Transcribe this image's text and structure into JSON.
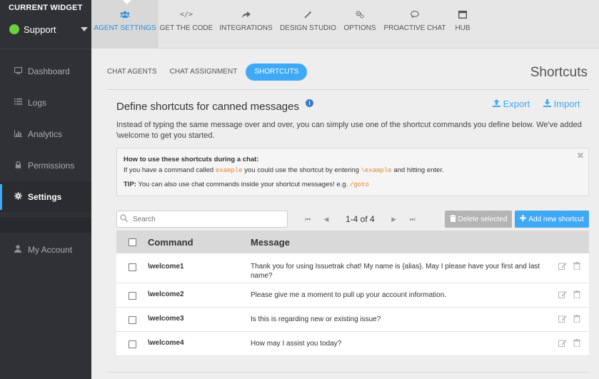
{
  "sidebar": {
    "widget_label": "CURRENT WIDGET",
    "widget_name": "Support",
    "items": [
      {
        "label": "Dashboard",
        "icon": "monitor-icon"
      },
      {
        "label": "Logs",
        "icon": "list-icon"
      },
      {
        "label": "Analytics",
        "icon": "bar-chart-icon"
      },
      {
        "label": "Permissions",
        "icon": "lock-icon"
      },
      {
        "label": "Settings",
        "icon": "gear-icon"
      }
    ],
    "account": {
      "label": "My Account",
      "icon": "user-icon"
    },
    "active_index": 4
  },
  "topnav": {
    "items": [
      {
        "label": "AGENT SETTINGS",
        "icon": "users-icon"
      },
      {
        "label": "GET THE CODE",
        "icon": "code-icon"
      },
      {
        "label": "INTEGRATIONS",
        "icon": "share-icon"
      },
      {
        "label": "DESIGN STUDIO",
        "icon": "magic-wand-icon"
      },
      {
        "label": "OPTIONS",
        "icon": "cogs-icon"
      },
      {
        "label": "PROACTIVE CHAT",
        "icon": "chat-bubble-icon"
      },
      {
        "label": "HUB",
        "icon": "window-icon"
      }
    ],
    "active_index": 0
  },
  "subtabs": {
    "items": [
      "CHAT AGENTS",
      "CHAT ASSIGNMENT",
      "SHORTCUTS"
    ],
    "active_index": 2
  },
  "page_title": "Shortcuts",
  "section": {
    "title": "Define shortcuts for canned messages",
    "export_label": "Export",
    "import_label": "Import",
    "description": "Instead of typing the same message over and over, you can simply use one of the shortcut commands you define below. We've added \\welcome to get you started."
  },
  "howto": {
    "title": "How to use these shortcuts during a chat:",
    "line_part1": "If you have a command called ",
    "line_code1": "example",
    "line_part2": " you could use the shortcut by entering ",
    "line_code2": "\\example",
    "line_part3": " and hitting enter.",
    "tip_label": "TIP:",
    "tip_text": " You can also use chat commands inside your shortcut messages! e.g. ",
    "tip_code": "/goto"
  },
  "toolbar": {
    "search_placeholder": "Search",
    "pager_text": "1-4 of 4",
    "delete_label": "Delete selected",
    "add_label": "Add new shortcut"
  },
  "table": {
    "headers": {
      "command": "Command",
      "message": "Message"
    },
    "rows": [
      {
        "command": "\\welcome1",
        "message": "Thank you for using Issuetrak chat!  My name is {alias}. May I please have your first and last name?"
      },
      {
        "command": "\\welcome2",
        "message": "Please give me a moment to pull up your account information."
      },
      {
        "command": "\\welcome3",
        "message": "Is this is regarding new or existing issue?"
      },
      {
        "command": "\\welcome4",
        "message": "How may I assist you today?"
      }
    ]
  },
  "colors": {
    "accent": "#3fa9f5",
    "sidebar_bg": "#2f3136",
    "status_online": "#6bd13f",
    "code_orange": "#e8842a"
  }
}
